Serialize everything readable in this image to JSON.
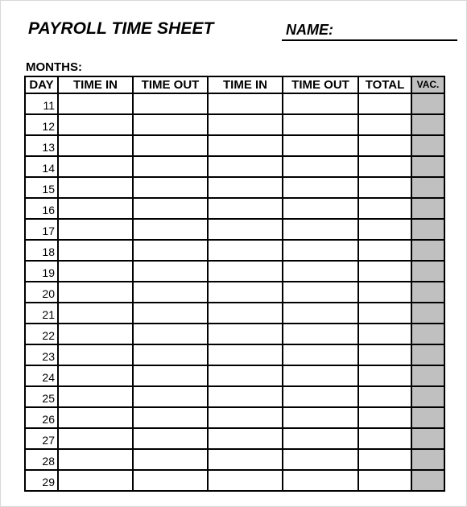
{
  "header": {
    "title": "PAYROLL TIME SHEET",
    "name_label": "NAME:",
    "name_value": "",
    "months_label": "MONTHS:"
  },
  "table": {
    "columns": [
      "DAY",
      "TIME IN",
      "TIME OUT",
      "TIME IN",
      "TIME OUT",
      "TOTAL",
      "VAC."
    ],
    "shaded_column_color": "#c0c0c0",
    "rows": [
      {
        "day": "11"
      },
      {
        "day": "12"
      },
      {
        "day": "13"
      },
      {
        "day": "14"
      },
      {
        "day": "15"
      },
      {
        "day": "16"
      },
      {
        "day": "17"
      },
      {
        "day": "18"
      },
      {
        "day": "19"
      },
      {
        "day": "20"
      },
      {
        "day": "21"
      },
      {
        "day": "22"
      },
      {
        "day": "23"
      },
      {
        "day": "24"
      },
      {
        "day": "25"
      },
      {
        "day": "26"
      },
      {
        "day": "27"
      },
      {
        "day": "28"
      },
      {
        "day": "29"
      }
    ]
  }
}
